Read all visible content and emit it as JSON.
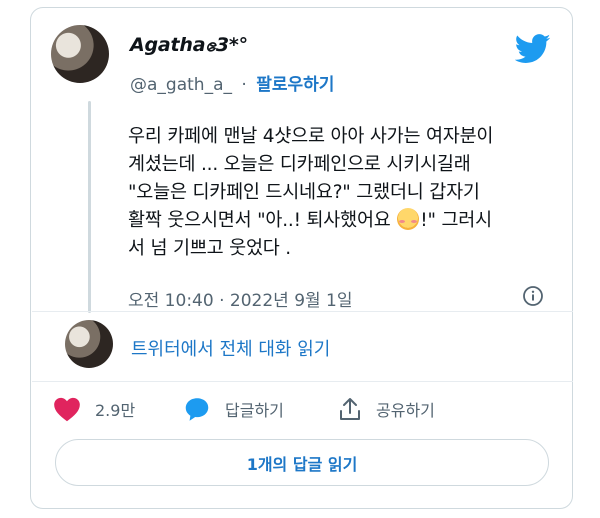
{
  "tweet": {
    "author": {
      "display_name": "Agathaဧ3*°",
      "handle": "@a_gath_a_",
      "separator": "·",
      "follow_label": "팔로우하기"
    },
    "text_lines": [
      "우리 카페에 맨날 4샷으로 아아 사가는 여자분이",
      "계셨는데 ... 오늘은 디카페인으로 시키시길래",
      "\"오늘은 디카페인 드시네요?\" 그랬더니 갑자기",
      "활짝 웃으시면서 \"아..! 퇴사했어요 ",
      "!\" 그러시",
      "서 넘 기쁘고 웃었다 ."
    ],
    "emoji": "smiling-face-with-blush",
    "timestamp": "오전 10:40 · 2022년 9월 1일",
    "conversation_link": "트위터에서 전체 대화 읽기",
    "actions": {
      "like_count": "2.9만",
      "reply_label": "답글하기",
      "share_label": "공유하기"
    },
    "read_replies_label": "1개의 답글 읽기"
  },
  "colors": {
    "link": "#1d77c7",
    "twitter_blue": "#1d9bf0",
    "like_pink": "#e0245e",
    "muted": "#536471",
    "border": "#cfd9de"
  },
  "icons": [
    "twitter-bird-icon",
    "info-icon",
    "heart-icon",
    "reply-bubble-icon",
    "share-icon"
  ]
}
